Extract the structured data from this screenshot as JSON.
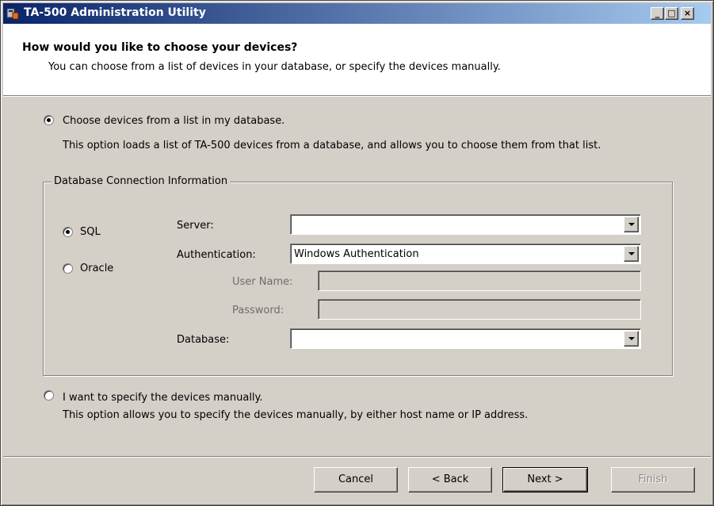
{
  "window": {
    "title": "TA-500 Administration Utility",
    "minimize_label": "_",
    "maximize_label": "□",
    "close_label": "×"
  },
  "header": {
    "title": "How would you like to choose your devices?",
    "subtitle": "You can choose from a list of devices in your database, or specify the devices manually."
  },
  "option_list": {
    "label": "Choose devices from a list in my database.",
    "description": "This option loads a list of TA-500 devices from a database, and allows you to choose them from that list.",
    "selected": true
  },
  "db_group": {
    "legend": "Database Connection Information",
    "sql_label": "SQL",
    "oracle_label": "Oracle",
    "sql_selected": true,
    "server_label": "Server:",
    "server_value": "",
    "auth_label": "Authentication:",
    "auth_value": "Windows Authentication",
    "username_label": "User Name:",
    "username_value": "",
    "password_label": "Password:",
    "password_value": "",
    "database_label": "Database:",
    "database_value": ""
  },
  "option_manual": {
    "label": "I want to specify the devices manually.",
    "description": "This option allows you to specify the devices manually, by either host name or IP address.",
    "selected": false
  },
  "buttons": {
    "cancel": "Cancel",
    "back": "< Back",
    "next": "Next >",
    "finish": "Finish"
  }
}
